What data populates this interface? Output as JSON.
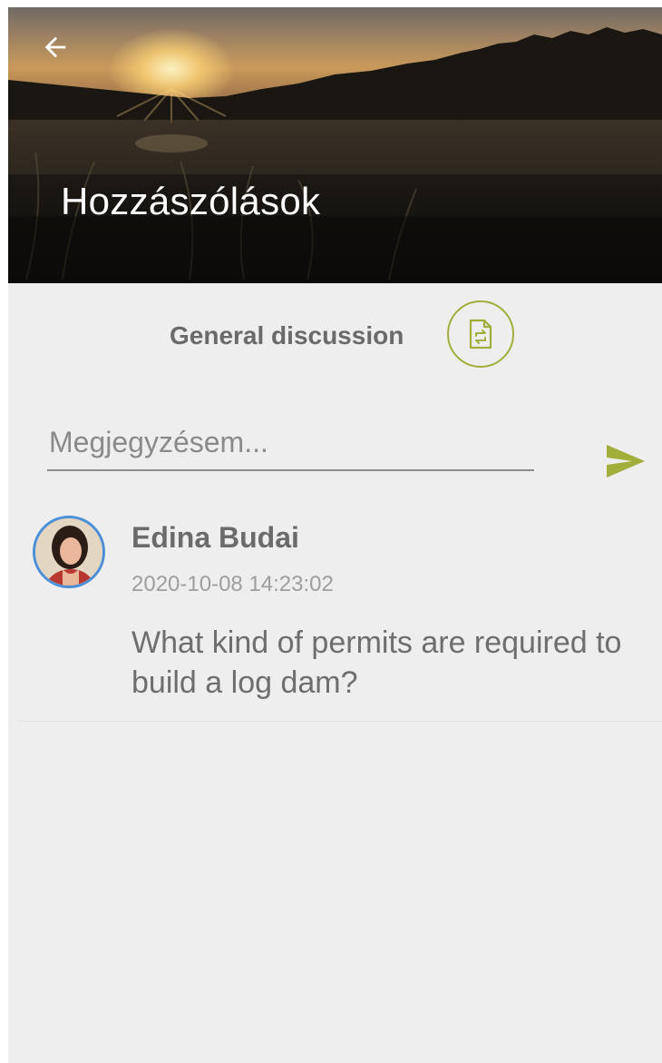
{
  "header": {
    "title": "Hozzászólások",
    "back_icon": "arrow-left-icon"
  },
  "discussion": {
    "label": "General discussion",
    "switch_icon": "document-switch-icon",
    "accent_color": "#a1ae3a"
  },
  "comment_input": {
    "placeholder": "Megjegyzésem...",
    "value": "",
    "send_icon": "send-icon"
  },
  "comments": [
    {
      "author": "Edina Budai",
      "timestamp": "2020-10-08 14:23:02",
      "text": "What kind of permits are required to build a log dam?",
      "avatar_icon": "user-avatar"
    }
  ],
  "colors": {
    "background": "#eeeeee",
    "accent": "#a1ae3a",
    "avatar_ring": "#4a90d9"
  }
}
